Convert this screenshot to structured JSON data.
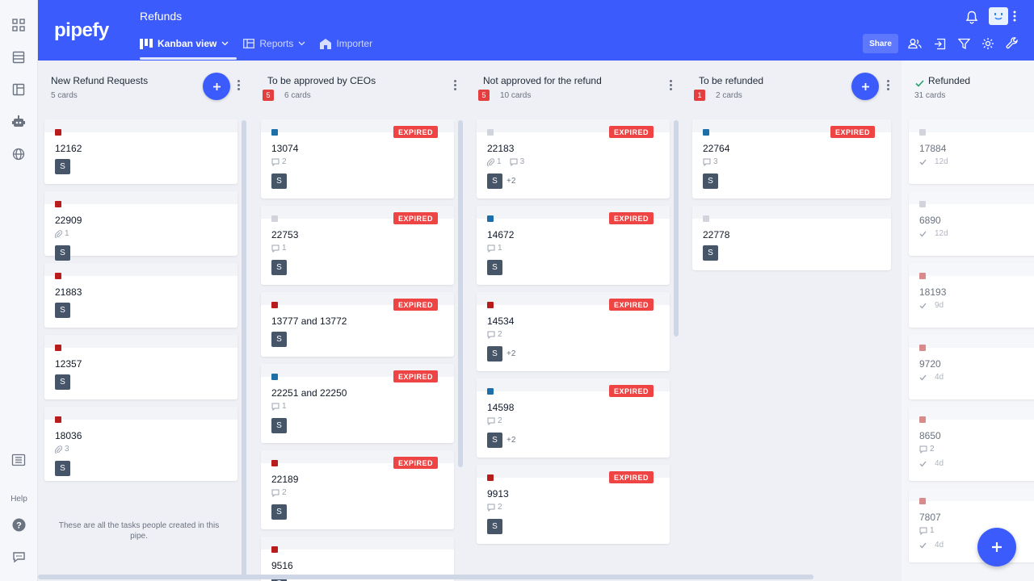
{
  "app": {
    "logo": "pipefy",
    "pipe_title": "Refunds"
  },
  "tabs": [
    {
      "label": "Kanban view"
    },
    {
      "label": "Reports"
    },
    {
      "label": "Importer"
    }
  ],
  "header": {
    "share_label": "Share"
  },
  "rail": {
    "help_label": "Help"
  },
  "colors": {
    "brand": "#3b5bfd",
    "expired": "#ef4444",
    "red_label": "#b91c1c",
    "blue_label": "#1e6fa8",
    "gray_label": "#d1d5db"
  },
  "phases": [
    {
      "title": "New Refund Requests",
      "count": "5 cards",
      "cards": [
        {
          "title": "12162"
        },
        {
          "title": "22909",
          "attachments": "1"
        },
        {
          "title": "21883"
        },
        {
          "title": "12357"
        },
        {
          "title": "18036",
          "attachments": "3"
        }
      ],
      "empty_note": "These are all the tasks people created in this pipe."
    },
    {
      "title": "To be approved by CEOs",
      "late": "5",
      "count": "6 cards",
      "cards": [
        {
          "title": "13074",
          "comments": "2",
          "expired": "EXPIRED"
        },
        {
          "title": "22753",
          "comments": "1",
          "expired": "EXPIRED"
        },
        {
          "title": "13777 and 13772",
          "expired": "EXPIRED"
        },
        {
          "title": "22251 and 22250",
          "comments": "1",
          "expired": "EXPIRED"
        },
        {
          "title": "22189",
          "comments": "2",
          "expired": "EXPIRED"
        },
        {
          "title": "9516"
        }
      ]
    },
    {
      "title": "Not approved for the refund",
      "late": "5",
      "count": "10 cards",
      "cards": [
        {
          "title": "22183",
          "attachments": "1",
          "comments": "3",
          "expired": "EXPIRED",
          "more": "+2"
        },
        {
          "title": "14672",
          "comments": "1",
          "expired": "EXPIRED"
        },
        {
          "title": "14534",
          "comments": "2",
          "expired": "EXPIRED",
          "more": "+2"
        },
        {
          "title": "14598",
          "comments": "2",
          "expired": "EXPIRED",
          "more": "+2"
        },
        {
          "title": "9913",
          "comments": "2",
          "expired": "EXPIRED"
        }
      ]
    },
    {
      "title": "To be refunded",
      "late": "1",
      "count": "2 cards",
      "cards": [
        {
          "title": "22764",
          "comments": "3",
          "expired": "EXPIRED"
        },
        {
          "title": "22778"
        }
      ]
    },
    {
      "title": "Refunded",
      "count": "31 cards",
      "cards": [
        {
          "title": "17884",
          "done": "12d"
        },
        {
          "title": "6890",
          "done": "12d"
        },
        {
          "title": "18193",
          "done": "9d"
        },
        {
          "title": "9720",
          "done": "4d"
        },
        {
          "title": "8650",
          "comments": "2",
          "done": "4d"
        },
        {
          "title": "7807",
          "comments": "1",
          "done": "4d"
        }
      ]
    }
  ],
  "assignee_initial": "S"
}
